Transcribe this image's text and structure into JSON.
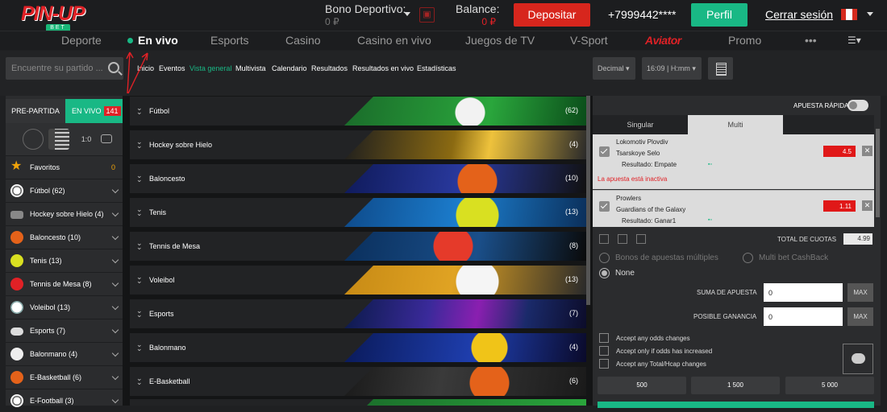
{
  "header": {
    "logo_text": "PIN-UP",
    "logo_sub": "BET",
    "bono_label": "Bono Deportivo:",
    "bono_value": "0 ₽",
    "balance_label": "Balance:",
    "balance_value": "0 ₽",
    "deposit": "Depositar",
    "phone": "+7999442****",
    "profile": "Perfil",
    "logout": "Cerrar sesión"
  },
  "nav": {
    "items": [
      "Deporte",
      "En vivo",
      "Esports",
      "Casino",
      "Casino en vivo",
      "Juegos de TV",
      "V-Sport",
      "Aviator",
      "Promo",
      "•••"
    ]
  },
  "sub": {
    "search_placeholder": "Encuentre su partido ...",
    "links": [
      "Inicio",
      "Eventos",
      "Vista general",
      "Multivista",
      "Calendario",
      "Resultados",
      "Resultados en vivo",
      "Estadísticas"
    ],
    "odds_format": "Decimal",
    "time_format": "16:09 | H:mm"
  },
  "sidebar": {
    "tab_pre": "PRE-PARTIDA",
    "tab_live": "EN VIVO",
    "live_count": "141",
    "items": [
      {
        "label": "Favoritos",
        "count": "0"
      },
      {
        "label": "Fútbol (62)"
      },
      {
        "label": "Hockey sobre Hielo (4)"
      },
      {
        "label": "Baloncesto (10)"
      },
      {
        "label": "Tenis (13)"
      },
      {
        "label": "Tennis de Mesa (8)"
      },
      {
        "label": "Voleibol (13)"
      },
      {
        "label": "Esports (7)"
      },
      {
        "label": "Balonmano (4)"
      },
      {
        "label": "E-Basketball (6)"
      },
      {
        "label": "E-Football (3)"
      }
    ]
  },
  "sports": [
    {
      "name": "Fútbol",
      "count": "(62)"
    },
    {
      "name": "Hockey sobre Hielo",
      "count": "(4)"
    },
    {
      "name": "Baloncesto",
      "count": "(10)"
    },
    {
      "name": "Tenis",
      "count": "(13)"
    },
    {
      "name": "Tennis de Mesa",
      "count": "(8)"
    },
    {
      "name": "Voleibol",
      "count": "(13)"
    },
    {
      "name": "Esports",
      "count": "(7)"
    },
    {
      "name": "Balonmano",
      "count": "(4)"
    },
    {
      "name": "E-Basketball",
      "count": "(6)"
    }
  ],
  "slip": {
    "quick_bet": "APUESTA RÁPIDA",
    "tab_single": "Singular",
    "tab_multi": "Multi",
    "bets": [
      {
        "team1": "Lokomotiv Plovdiv",
        "team2": "Tsarskoye Selo",
        "result": "Resultado: Empate",
        "odd": "4.5",
        "warning": "La apuesta está inactiva"
      },
      {
        "team1": "Prowlers",
        "team2": "Guardians of the Galaxy",
        "result": "Resultado: Ganar1",
        "odd": "1.11"
      }
    ],
    "total_label": "TOTAL DE CUOTAS",
    "total_value": "4.99",
    "opt_multi": "Bonos de apuestas múltiples",
    "opt_cashback": "Multi bet CashBack",
    "opt_none": "None",
    "stake_label": "SUMA DE APUESTA",
    "stake_value": "0",
    "gain_label": "POSIBLE GANANCIA",
    "gain_value": "0",
    "max": "MAX",
    "checks": [
      "Accept any odds changes",
      "Accept only if odds has increased",
      "Accept any Total/Hcap changes"
    ],
    "amounts": [
      "500",
      "1 500",
      "5 000"
    ]
  },
  "colors": {
    "accent": "#19b885",
    "brand": "#e02126"
  }
}
